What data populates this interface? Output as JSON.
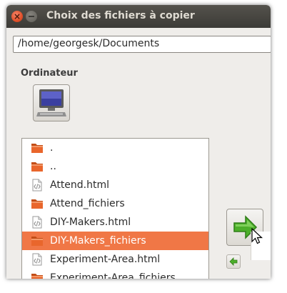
{
  "window": {
    "title": "Choix des fichiers à copier",
    "close_icon": "close-icon",
    "minimize_icon": "minimize-icon"
  },
  "location": {
    "path": "/home/georgesk/Documents"
  },
  "places": {
    "label": "Ordinateur",
    "icon": "computer-icon"
  },
  "files": [
    {
      "name": ".",
      "type": "folder",
      "selected": false
    },
    {
      "name": "..",
      "type": "folder",
      "selected": false
    },
    {
      "name": "Attend.html",
      "type": "html",
      "selected": false
    },
    {
      "name": "Attend_fichiers",
      "type": "folder",
      "selected": false
    },
    {
      "name": "DIY-Makers.html",
      "type": "html",
      "selected": false
    },
    {
      "name": "DIY-Makers_fichiers",
      "type": "folder",
      "selected": true
    },
    {
      "name": "Experiment-Area.html",
      "type": "html",
      "selected": false
    },
    {
      "name": "Experiment-Area_fichiers",
      "type": "folder",
      "selected": false
    }
  ],
  "actions": {
    "add_icon": "arrow-right-icon",
    "remove_icon": "arrow-left-icon"
  },
  "colors": {
    "selection": "#f07746",
    "folder": "#e9662c",
    "arrow": "#4caf2a",
    "titlebar": "#3c3b37"
  }
}
